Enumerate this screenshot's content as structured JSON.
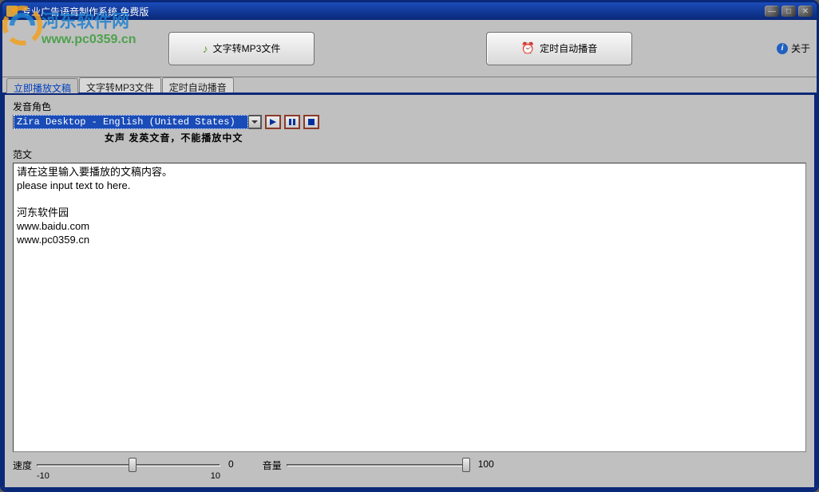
{
  "titlebar": {
    "title": "专业广告语音制作系统 免费版"
  },
  "toolbar": {
    "btn_text_to_mp3": "文字转MP3文件",
    "btn_scheduled_play": "定时自动播音",
    "about": "关于"
  },
  "tabs": {
    "play_now": "立即播放文稿",
    "text_to_mp3": "文字转MP3文件",
    "scheduled": "定时自动播音"
  },
  "panel": {
    "voice_role_label": "发音角色",
    "voice_combo_value": "Zira Desktop - English (United States)",
    "voice_note": "女声  发英文音，不能播放中文",
    "text_label": "范文",
    "text_content": "请在这里输入要播放的文稿内容。\nplease input text to here.\n\n河东软件园\nwww.baidu.com\nwww.pc0359.cn"
  },
  "sliders": {
    "speed_label": "速度",
    "speed_min": "-10",
    "speed_max": "10",
    "speed_value": "0",
    "volume_label": "音量",
    "volume_value": "100"
  },
  "watermark": {
    "line1": "河东软件网",
    "line2": "www.pc0359.cn"
  }
}
